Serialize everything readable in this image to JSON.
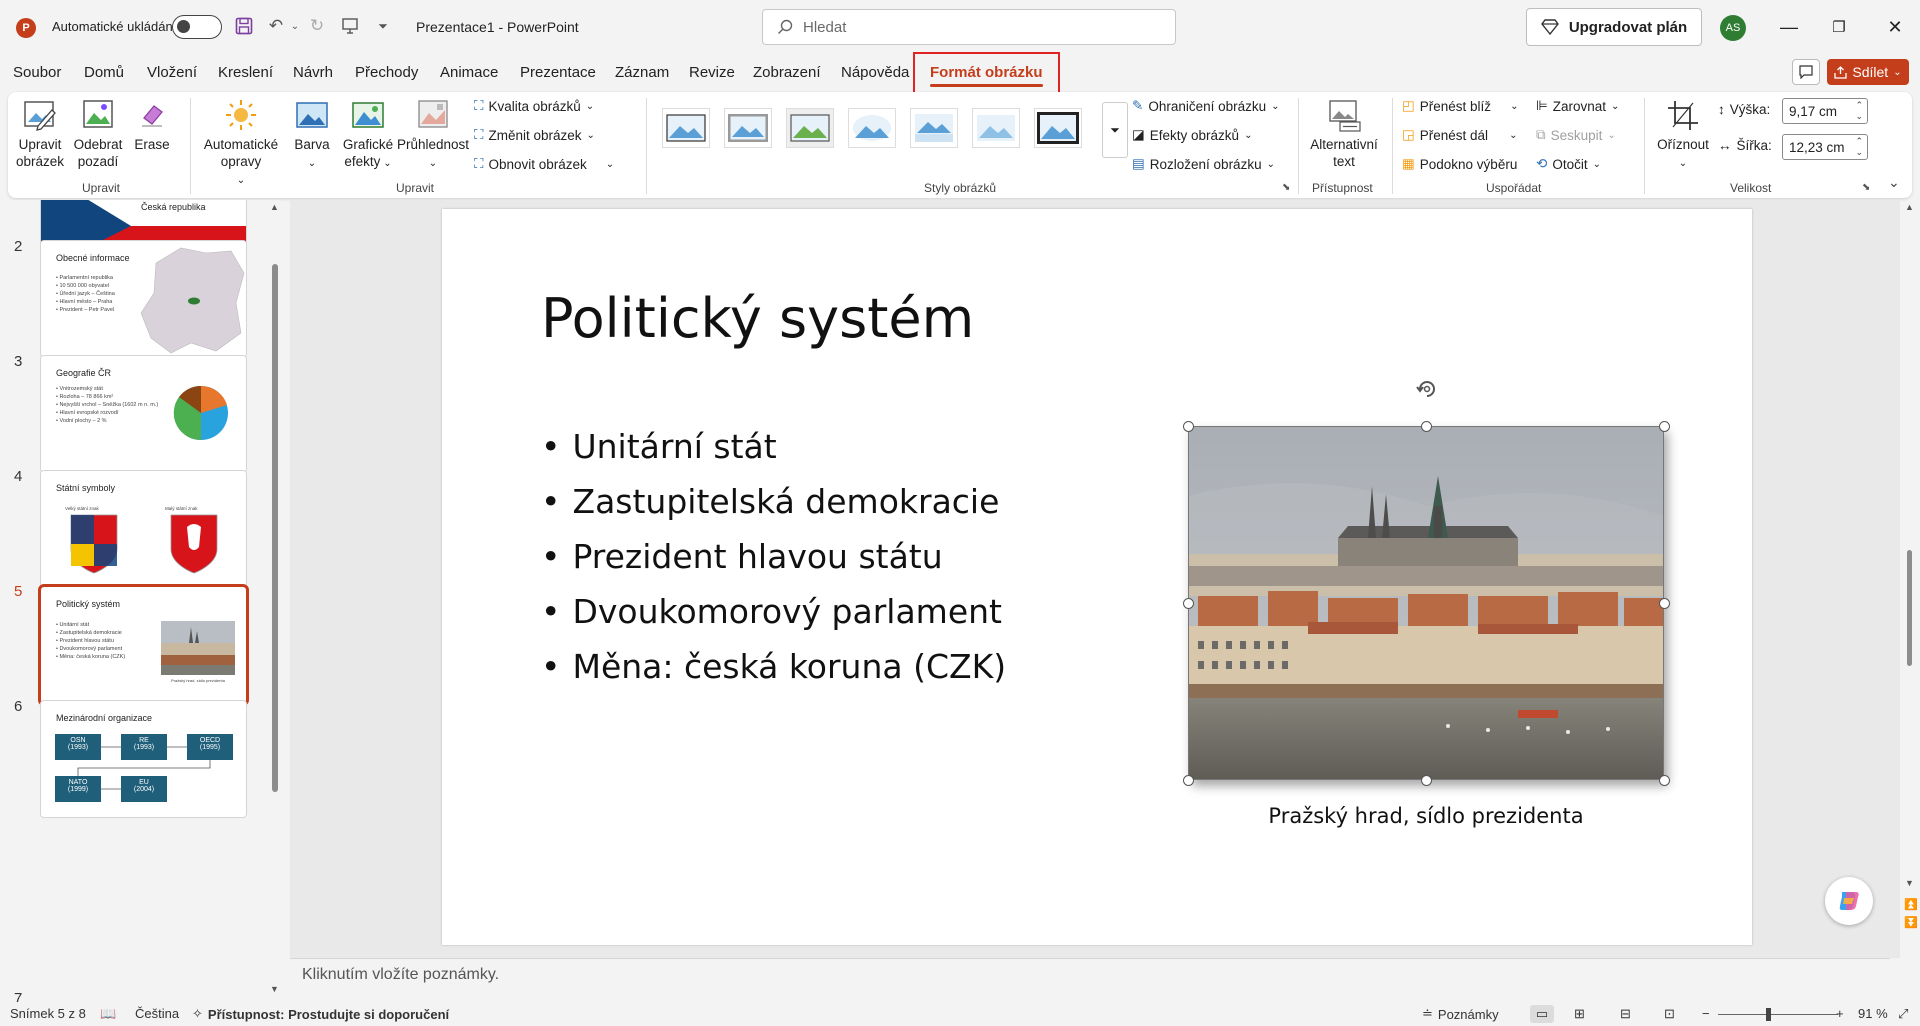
{
  "titlebar": {
    "autosave_label": "Automatické ukládání",
    "doc_title": "Prezentace1  -  PowerPoint",
    "search_placeholder": "Hledat",
    "upgrade_label": "Upgradovat plán",
    "avatar_initials": "AS"
  },
  "tabs": [
    "Soubor",
    "Domů",
    "Vložení",
    "Kreslení",
    "Návrh",
    "Přechody",
    "Animace",
    "Prezentace",
    "Záznam",
    "Revize",
    "Zobrazení",
    "Nápověda",
    "Formát obrázku"
  ],
  "active_tab": "Formát obrázku",
  "share_label": "Sdílet",
  "ribbon": {
    "adjust_btns": {
      "edit_picture": "Upravit obrázek",
      "remove_bg": "Odebrat pozadí",
      "erase": "Erase",
      "auto_fix": "Automatické opravy",
      "color": "Barva",
      "artistic": "Grafické efekty",
      "transparency": "Průhlednost"
    },
    "adjust_small": {
      "quality": "Kvalita obrázků",
      "change": "Změnit obrázek",
      "reset": "Obnovit obrázek"
    },
    "groups": {
      "upravit1": "Upravit",
      "upravit2": "Upravit",
      "styles": "Styly obrázků",
      "access": "Přístupnost",
      "arrange": "Uspořádat",
      "size": "Velikost"
    },
    "styles_small": {
      "border": "Ohraničení obrázku",
      "effects": "Efekty obrázků",
      "layout": "Rozložení obrázku"
    },
    "alt_text": "Alternativní text",
    "arrange": {
      "forward": "Přenést blíž",
      "backward": "Přenést dál",
      "pane": "Podokno výběru",
      "align": "Zarovnat",
      "group": "Seskupit",
      "rotate": "Otočit"
    },
    "crop": "Oříznout",
    "height_label": "Výška:",
    "height_value": "9,17 cm",
    "width_label": "Šířka:",
    "width_value": "12,23 cm"
  },
  "thumbnails": [
    {
      "num": "2",
      "title": "Obecné informace",
      "lines": [
        "• Parlamentní republika",
        "• 10 500 000 obyvatel",
        "• Úřední jazyk – Čeština",
        "• Hlavní město – Praha",
        "• Prezident – Petr Pavel"
      ]
    },
    {
      "num": "3",
      "title": "Geografie ČR",
      "lines": [
        "• Vnitrozemský stát",
        "• Rozloha – 78 866 km²",
        "• Nejvyšší vrchol – Sněžka (1602 m n. m.)",
        "• Hlavní evropské rozvodí",
        "• Vodní plochy – 2 %"
      ]
    },
    {
      "num": "4",
      "title": "Státní symboly",
      "lines": [
        "Velký státní znak",
        "Malý státní znak"
      ]
    },
    {
      "num": "5",
      "title": "Politický systém",
      "lines": [
        "• Unitární stát",
        "• Zastupitelská demokracie",
        "• Prezident hlavou státu",
        "• Dvoukomorový parlament",
        "• Měna: česká koruna (CZK)"
      ],
      "caption": "Pražský hrad, sídlo prezidenta"
    },
    {
      "num": "6",
      "title": "Mezinárodní organizace",
      "orgs": [
        "OSN\n(1993)",
        "RE\n(1993)",
        "OECD\n(1995)",
        "NATO\n(1999)",
        "EU\n(2004)"
      ]
    },
    {
      "num": "7"
    }
  ],
  "thumb1_label": "Česká republika",
  "slide": {
    "title": "Politický systém",
    "bullets": [
      "Unitární stát",
      "Zastupitelská demokracie",
      "Prezident hlavou státu",
      "Dvoukomorový parlament",
      "Měna: česká koruna (CZK)"
    ],
    "caption": "Pražský hrad, sídlo prezidenta"
  },
  "notes_placeholder": "Kliknutím vložíte poznámky.",
  "status": {
    "slide_of": "Snímek 5 z 8",
    "language": "Čeština",
    "accessibility": "Přístupnost: Prostudujte si doporučení",
    "notes": "Poznámky",
    "zoom": "91 %"
  },
  "colors": {
    "accent": "#c43e1c",
    "highlight": "#e02424",
    "org_box": "#1f5f7a"
  }
}
